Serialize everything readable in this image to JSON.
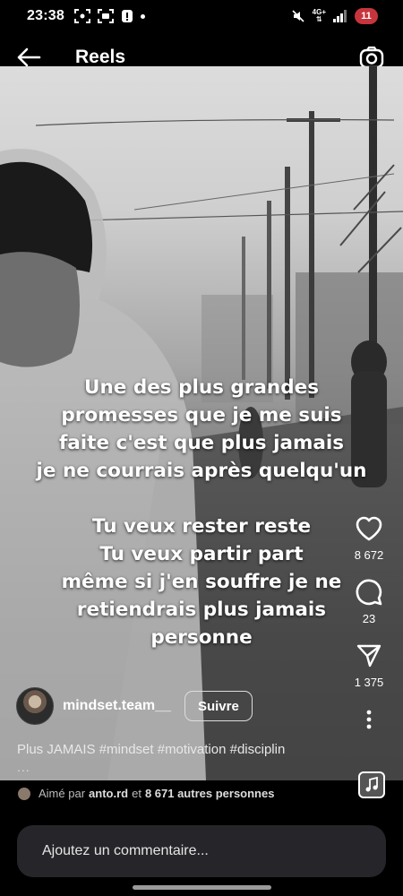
{
  "status_bar": {
    "time": "23:38",
    "network_top": "4G+",
    "battery": "11"
  },
  "header": {
    "title": "Reels"
  },
  "video": {
    "overlay_lines": [
      "Une des plus grandes",
      "promesses que je me suis",
      "faite c'est que plus jamais",
      "je ne courrais après quelqu'un",
      "",
      "Tu veux rester reste",
      "Tu veux partir part",
      "même si j'en souffre je ne",
      "retiendrais plus jamais",
      "personne"
    ]
  },
  "actions": {
    "likes": "8 672",
    "comments": "23",
    "shares": "1 375"
  },
  "author": {
    "username": "mindset.team__",
    "follow_label": "Suivre"
  },
  "caption": {
    "text": "Plus JAMAIS #mindset #motivation #disciplin",
    "more": "..."
  },
  "liked_by": {
    "prefix": "Aimé par",
    "user": "anto.rd",
    "conjunction": "et",
    "others": "8 671 autres personnes"
  },
  "comment": {
    "placeholder": "Ajoutez un commentaire..."
  },
  "icons": [
    "back-arrow-icon",
    "camera-icon",
    "heart-icon",
    "comment-icon",
    "send-icon",
    "more-icon",
    "music-icon"
  ]
}
